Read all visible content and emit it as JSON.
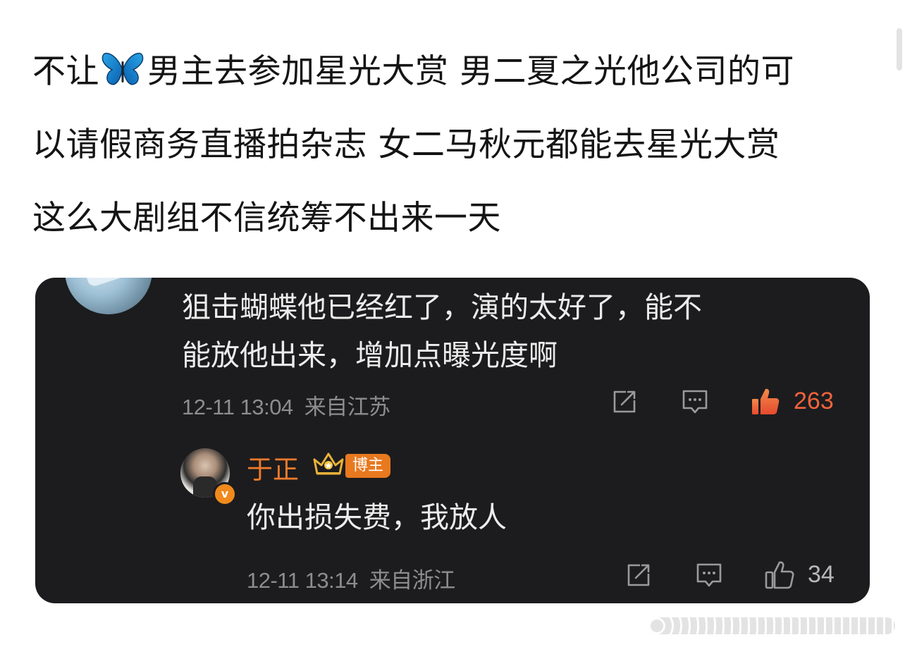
{
  "post": {
    "line1_before": "不让",
    "line1_after": "男主去参加星光大赏 男二夏之光他公司的可",
    "line2": "以请假商务直播拍杂志 女二马秋元都能去星光大赏",
    "line3": "这么大剧组不信统筹不出来一天",
    "emoji": "butterfly-emoji"
  },
  "comment": {
    "text_line1": "狙击蝴蝶他已经红了，演的太好了，能不",
    "text_line2": "能放他出来，增加点曝光度啊",
    "time": "12-11 13:04",
    "location": "来自江苏",
    "likes": "263",
    "liked": true
  },
  "reply": {
    "name": "于正",
    "badge": "博主",
    "text": "你出损失费，我放人",
    "time": "12-11 13:14",
    "location": "来自浙江",
    "likes": "34",
    "liked": false
  },
  "colors": {
    "card_bg": "#1c1c1e",
    "accent_orange": "#f07b2b",
    "like_red": "#f0633c",
    "meta_gray": "#8d8d8f"
  }
}
